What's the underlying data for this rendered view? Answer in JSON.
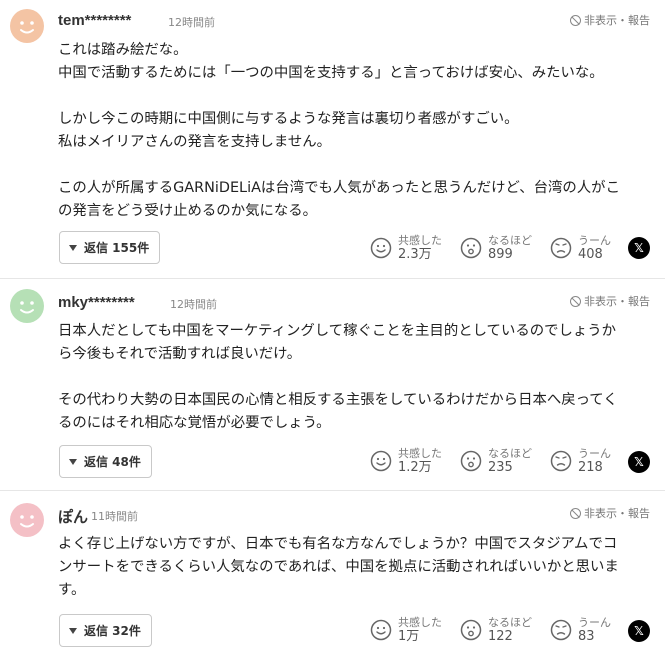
{
  "report_label": "非表示・報告",
  "reaction_labels": {
    "empathy": "共感した",
    "insight": "なるほど",
    "hmm": "うーん"
  },
  "colors": {
    "avatar_orange": "#f4c4a4",
    "avatar_green": "#b6e0b6",
    "avatar_pink": "#f4c0c6"
  },
  "comments": [
    {
      "username": "tem********",
      "time": "12時間前",
      "avatar_color": "orange",
      "text": "これは踏み絵だな。\n中国で活動するためには「一つの中国を支持する」と言っておけば安心、みたいな。\n\nしかし今この時期に中国側に与するような発言は裏切り者感がすごい。\n私はメイリアさんの発言を支持しません。\n\nこの人が所属するGARNiDELiAは台湾でも人気があったと思うんだけど、台湾の人がこ\nの発言をどう受け止めるのか気になる。",
      "reply_label": "返信 155件",
      "empathy": "2.3万",
      "insight": "899",
      "hmm": "408"
    },
    {
      "username": "mky********",
      "time": "12時間前",
      "avatar_color": "green",
      "text": "日本人だとしても中国をマーケティングして稼ぐことを主目的としているのでしょうか\nら今後もそれで活動すれば良いだけ。\n\nその代わり大勢の日本国民の心情と相反する主張をしているわけだから日本へ戻ってく\nるのにはそれ相応な覚悟が必要でしょう。",
      "reply_label": "返信 48件",
      "empathy": "1.2万",
      "insight": "235",
      "hmm": "218"
    },
    {
      "username": "ぽん",
      "time": "11時間前",
      "avatar_color": "pink",
      "text": "よく存じ上げない方ですが、日本でも有名な方なんでしょうか？中国でスタジアムでコ\nンサートをできるくらい人気なのであれば、中国を拠点に活動されればいいかと思いま\nす。",
      "reply_label": "返信 32件",
      "empathy": "1万",
      "insight": "122",
      "hmm": "83"
    }
  ]
}
